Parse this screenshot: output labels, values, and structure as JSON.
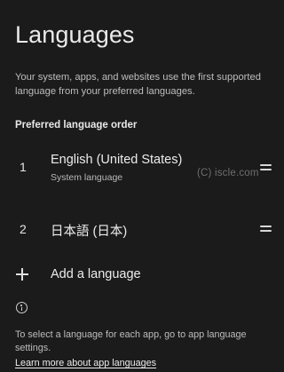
{
  "page": {
    "title": "Languages",
    "description": "Your system, apps, and websites use the first supported language from your preferred languages."
  },
  "preferred": {
    "header": "Preferred language order",
    "items": [
      {
        "number": "1",
        "name": "English (United States)",
        "subtitle": "System language"
      },
      {
        "number": "2",
        "name": "日本語 (日本)"
      }
    ]
  },
  "watermark": "(C) iscle.com",
  "add_language": {
    "label": "Add a language",
    "icon": "plus-icon"
  },
  "footer": {
    "info_icon": "info-icon",
    "note": "To select a language for each app, go to app language settings.",
    "link": "Learn more about app languages"
  }
}
